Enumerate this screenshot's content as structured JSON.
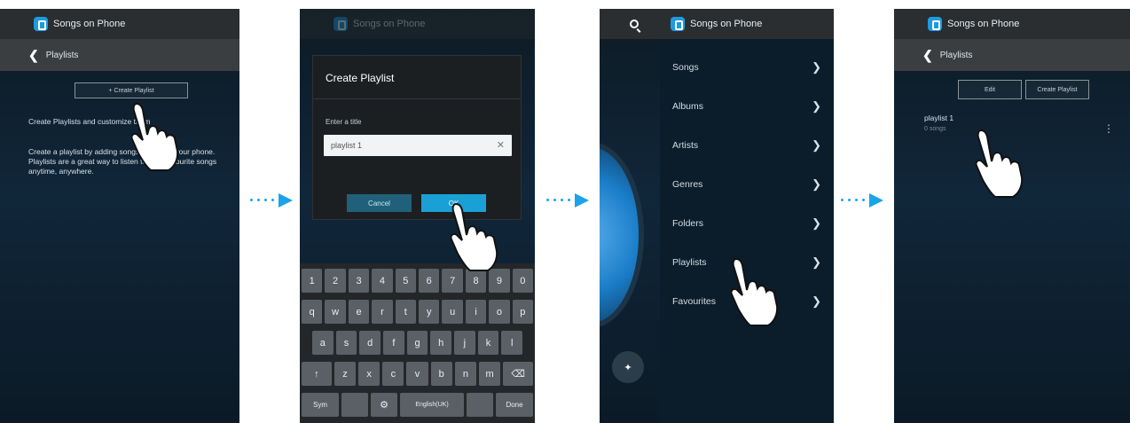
{
  "screen1": {
    "app_title": "Songs on Phone",
    "back_label": "Playlists",
    "create_button": "+ Create Playlist",
    "heading": "Create Playlists and customize them",
    "body": "Create a playlist by adding songs stored on your phone. Playlists are a great way to listen to your favourite songs anytime, anywhere."
  },
  "screen2": {
    "app_title": "Songs on Phone",
    "dialog_title": "Create Playlist",
    "field_label": "Enter a title",
    "field_value": "playlist 1",
    "cancel_label": "Cancel",
    "ok_label": "OK",
    "keyboard": {
      "row1": [
        "1",
        "2",
        "3",
        "4",
        "5",
        "6",
        "7",
        "8",
        "9",
        "0"
      ],
      "row2": [
        "q",
        "w",
        "e",
        "r",
        "t",
        "y",
        "u",
        "i",
        "o",
        "p"
      ],
      "row3": [
        "a",
        "s",
        "d",
        "f",
        "g",
        "h",
        "j",
        "k",
        "l"
      ],
      "row4": [
        "↑",
        "z",
        "x",
        "c",
        "v",
        "b",
        "n",
        "m",
        "⌫"
      ],
      "row5": [
        "Sym",
        "",
        "⚙",
        "English(UK)",
        "",
        "Done"
      ]
    }
  },
  "screen3": {
    "app_title": "Songs on Phone",
    "menu": [
      "Songs",
      "Albums",
      "Artists",
      "Genres",
      "Folders",
      "Playlists",
      "Favourites"
    ]
  },
  "screen4": {
    "app_title": "Songs on Phone",
    "back_label": "Playlists",
    "edit_button": "Edit",
    "create_button": "Create Playlist",
    "playlist_name": "playlist 1",
    "playlist_meta": "0 songs"
  },
  "colors": {
    "accent": "#1aa3e8",
    "bar": "#2a2e31"
  }
}
